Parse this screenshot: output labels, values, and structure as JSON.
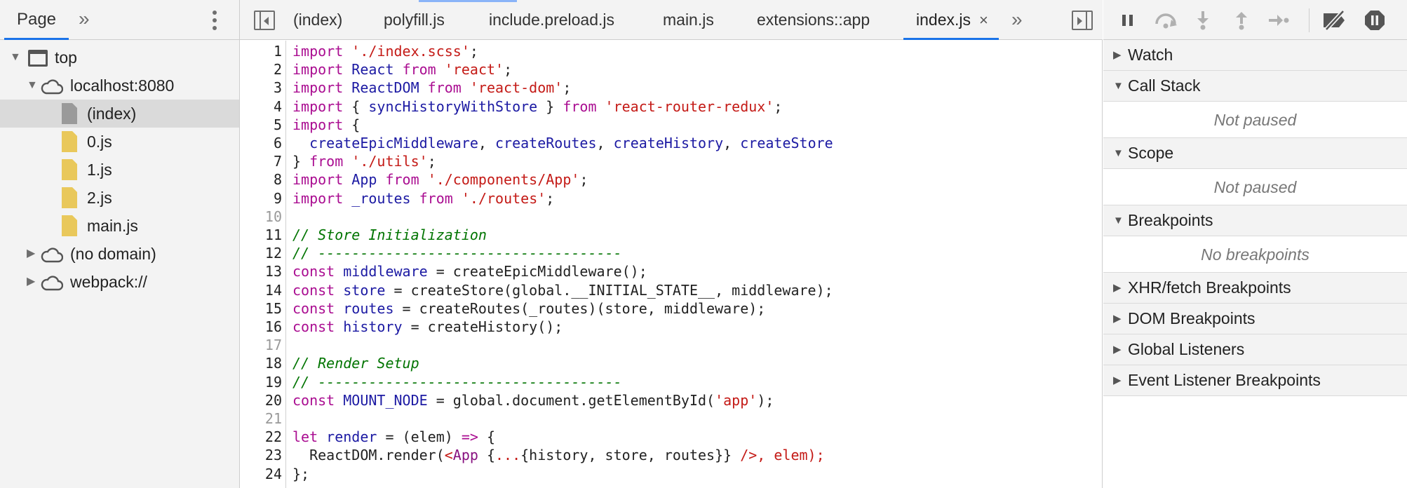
{
  "navigator": {
    "tab_label": "Page",
    "more_glyph": "»",
    "menu_icon": "kebab-menu-icon",
    "tree": [
      {
        "label": "top",
        "icon": "frame-icon",
        "expanded": true,
        "depth": 0
      },
      {
        "label": "localhost:8080",
        "icon": "cloud-icon",
        "expanded": true,
        "depth": 1
      },
      {
        "label": "(index)",
        "icon": "document-icon",
        "depth": 2,
        "selected": true
      },
      {
        "label": "0.js",
        "icon": "js-file-icon",
        "depth": 2
      },
      {
        "label": "1.js",
        "icon": "js-file-icon",
        "depth": 2
      },
      {
        "label": "2.js",
        "icon": "js-file-icon",
        "depth": 2
      },
      {
        "label": "main.js",
        "icon": "js-file-icon",
        "depth": 2
      },
      {
        "label": "(no domain)",
        "icon": "cloud-icon",
        "expanded": false,
        "depth": 1
      },
      {
        "label": "webpack://",
        "icon": "cloud-icon",
        "expanded": false,
        "depth": 1
      }
    ]
  },
  "editor": {
    "tabs": [
      {
        "label": "(index)"
      },
      {
        "label": "polyfill.js"
      },
      {
        "label": "include.preload.js"
      },
      {
        "label": "main.js"
      },
      {
        "label": "extensions::app"
      },
      {
        "label": "index.js",
        "active": true,
        "close_glyph": "×"
      }
    ],
    "overflow_glyph": "»",
    "lines": [
      {
        "n": "1",
        "text": "import './index.scss';"
      },
      {
        "n": "2",
        "text": "import React from 'react';"
      },
      {
        "n": "3",
        "text": "import ReactDOM from 'react-dom';"
      },
      {
        "n": "4",
        "text": "import { syncHistoryWithStore } from 'react-router-redux';"
      },
      {
        "n": "5",
        "text": "import {"
      },
      {
        "n": "6",
        "text": "  createEpicMiddleware, createRoutes, createHistory, createStore"
      },
      {
        "n": "7",
        "text": "} from './utils';"
      },
      {
        "n": "8",
        "text": "import App from './components/App';"
      },
      {
        "n": "9",
        "text": "import _routes from './routes';"
      },
      {
        "n": "10",
        "text": ""
      },
      {
        "n": "11",
        "text": "// Store Initialization"
      },
      {
        "n": "12",
        "text": "// ------------------------------------"
      },
      {
        "n": "13",
        "text": "const middleware = createEpicMiddleware();"
      },
      {
        "n": "14",
        "text": "const store = createStore(global.__INITIAL_STATE__, middleware);"
      },
      {
        "n": "15",
        "text": "const routes = createRoutes(_routes)(store, middleware);"
      },
      {
        "n": "16",
        "text": "const history = createHistory();"
      },
      {
        "n": "17",
        "text": ""
      },
      {
        "n": "18",
        "text": "// Render Setup"
      },
      {
        "n": "19",
        "text": "// ------------------------------------"
      },
      {
        "n": "20",
        "text": "const MOUNT_NODE = global.document.getElementById('app');"
      },
      {
        "n": "21",
        "text": ""
      },
      {
        "n": "22",
        "text": "let render = (elem) => {"
      },
      {
        "n": "23",
        "text": "  ReactDOM.render(<App {...{history, store, routes}} />, elem);"
      },
      {
        "n": "24",
        "text": "};"
      }
    ]
  },
  "debugger": {
    "toolbar": [
      {
        "name": "pause-resume-button",
        "icon": "pause-icon"
      },
      {
        "name": "step-over-button",
        "icon": "step-over-icon"
      },
      {
        "name": "step-into-button",
        "icon": "step-into-icon"
      },
      {
        "name": "step-out-button",
        "icon": "step-out-icon"
      },
      {
        "name": "step-button",
        "icon": "step-icon"
      },
      {
        "name": "deactivate-breakpoints-button",
        "icon": "deactivate-breakpoints-icon"
      },
      {
        "name": "pause-on-exceptions-button",
        "icon": "pause-on-exceptions-icon"
      }
    ],
    "panes": [
      {
        "title": "Watch",
        "expanded": false
      },
      {
        "title": "Call Stack",
        "expanded": true,
        "body": "Not paused"
      },
      {
        "title": "Scope",
        "expanded": true,
        "body": "Not paused"
      },
      {
        "title": "Breakpoints",
        "expanded": true,
        "body": "No breakpoints"
      },
      {
        "title": "XHR/fetch Breakpoints",
        "expanded": false
      },
      {
        "title": "DOM Breakpoints",
        "expanded": false
      },
      {
        "title": "Global Listeners",
        "expanded": false
      },
      {
        "title": "Event Listener Breakpoints",
        "expanded": false
      }
    ]
  },
  "colors": {
    "keyword": "#aa0d91",
    "string": "#c41a16",
    "identifier": "#1c1aa3",
    "comment": "#007400",
    "active_tab": "#1a73e8"
  }
}
